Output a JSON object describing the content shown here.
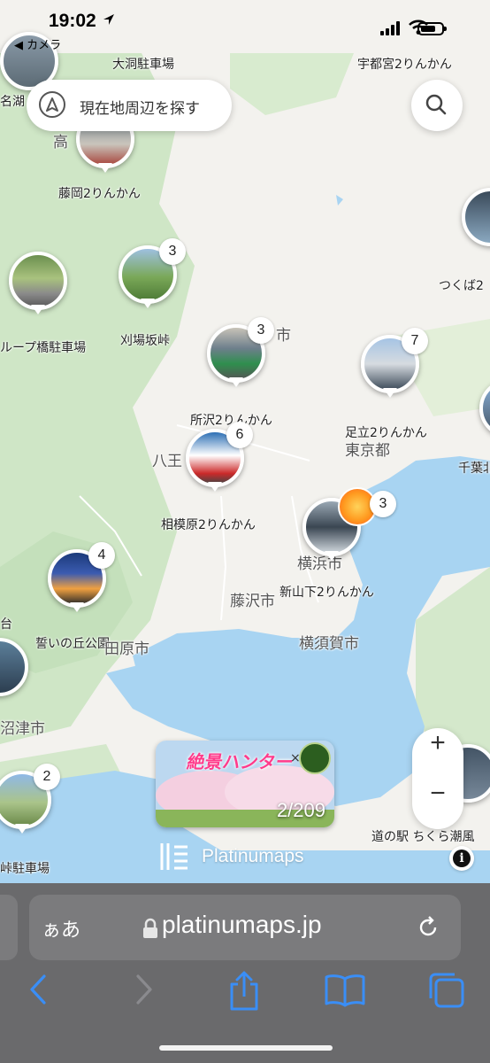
{
  "status_bar": {
    "time": "19:02",
    "back_app": "◀ カメラ"
  },
  "search": {
    "label": "現在地周辺を探す"
  },
  "map_labels": [
    {
      "text": "大洞駐車場",
      "kind": "poi"
    },
    {
      "text": "宇都宮2りんかん",
      "kind": "poi"
    },
    {
      "text": "名湖",
      "kind": "poi"
    },
    {
      "text": "高",
      "kind": "city"
    },
    {
      "text": "藤岡2りんかん",
      "kind": "poi"
    },
    {
      "text": "つくば2",
      "kind": "poi"
    },
    {
      "text": "ループ橋駐車場",
      "kind": "poi"
    },
    {
      "text": "刈場坂峠",
      "kind": "poi"
    },
    {
      "text": "市",
      "kind": "city"
    },
    {
      "text": "所沢2りんかん",
      "kind": "poi"
    },
    {
      "text": "足立2りんかん",
      "kind": "poi"
    },
    {
      "text": "東京都",
      "kind": "city"
    },
    {
      "text": "千葉北",
      "kind": "poi"
    },
    {
      "text": "八王",
      "kind": "city"
    },
    {
      "text": "相模原2りんかん",
      "kind": "poi"
    },
    {
      "text": "横浜市",
      "kind": "city"
    },
    {
      "text": "藤沢市",
      "kind": "city"
    },
    {
      "text": "新山下2りんかん",
      "kind": "poi"
    },
    {
      "text": "台",
      "kind": "poi"
    },
    {
      "text": "誓いの丘公園",
      "kind": "poi"
    },
    {
      "text": "田原市",
      "kind": "city"
    },
    {
      "text": "横須賀市",
      "kind": "city"
    },
    {
      "text": "沼津市",
      "kind": "city"
    },
    {
      "text": "道の駅 ちくら潮風",
      "kind": "poi"
    },
    {
      "text": "峠駐車場",
      "kind": "poi"
    }
  ],
  "markers": [
    {
      "count": "3"
    },
    {
      "count": "3"
    },
    {
      "count": "7"
    },
    {
      "count": "6"
    },
    {
      "count": "3"
    },
    {
      "count": "4"
    },
    {
      "count": "2"
    }
  ],
  "zoom": {
    "plus": "+",
    "minus": "−"
  },
  "banner": {
    "title": "絶景ハンター",
    "cross": "×",
    "counter": "2/209"
  },
  "brand": {
    "name": "Platinumaps"
  },
  "browser": {
    "aa": "ぁあ",
    "url": "platinumaps.jp"
  },
  "colors": {
    "water": "#a8d4f2",
    "forest": "#cfe6c6",
    "land": "#f3f2ee",
    "ios_blue": "#3a8ef6"
  }
}
